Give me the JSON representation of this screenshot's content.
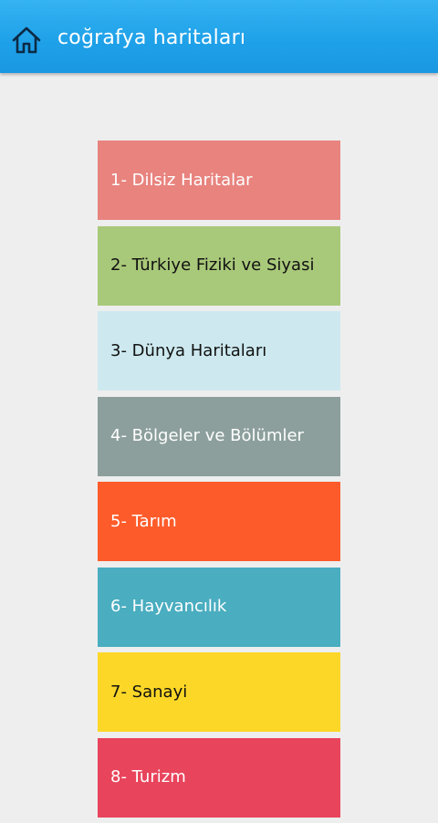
{
  "header": {
    "title": "coğrafya haritaları",
    "home_icon": "home-icon",
    "background": "#1ea0e8"
  },
  "menu": {
    "items": [
      {
        "label": "1- Dilsiz Haritalar",
        "color": "#e8837e",
        "text_color": "#ffffff"
      },
      {
        "label": "2- Türkiye Fiziki ve Siyasi",
        "color": "#a9c97a",
        "text_color": "#111111"
      },
      {
        "label": "3- Dünya Haritaları",
        "color": "#cde9ef",
        "text_color": "#111111"
      },
      {
        "label": "4- Bölgeler ve Bölümler",
        "color": "#8c9f9c",
        "text_color": "#ffffff"
      },
      {
        "label": "5- Tarım",
        "color": "#fe5b2a",
        "text_color": "#ffffff"
      },
      {
        "label": "6- Hayvancılık",
        "color": "#4aadc0",
        "text_color": "#ffffff"
      },
      {
        "label": "7- Sanayi",
        "color": "#fcd727",
        "text_color": "#111111"
      },
      {
        "label": "8- Turizm",
        "color": "#e8445c",
        "text_color": "#ffffff"
      }
    ]
  }
}
